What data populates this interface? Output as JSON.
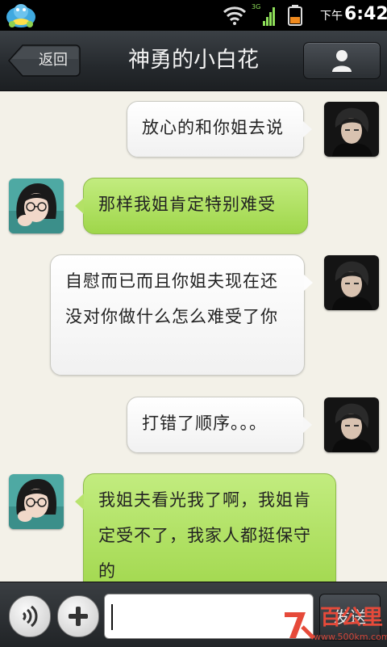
{
  "status_bar": {
    "network_label": "3G",
    "ampm": "下午",
    "time": "6:42",
    "icons": [
      "app-notification-icon",
      "wifi-icon",
      "signal-icon",
      "battery-icon"
    ]
  },
  "header": {
    "back_label": "返回",
    "title": "神勇的小白花",
    "profile_icon": "person-icon"
  },
  "messages": [
    {
      "side": "right",
      "style": "white",
      "text": "放心的和你姐去说",
      "avatar": "friend-avatar"
    },
    {
      "side": "left",
      "style": "green",
      "text": "那样我姐肯定特别难受",
      "avatar": "user-avatar"
    },
    {
      "side": "right",
      "style": "white",
      "text": "自慰而已而且你姐夫现在还没对你做什么怎么难受了你",
      "avatar": "friend-avatar"
    },
    {
      "side": "right",
      "style": "white",
      "text": "打错了顺序。。。",
      "avatar": "friend-avatar"
    },
    {
      "side": "left",
      "style": "green",
      "text": "我姐夫看光我了啊，我姐肯定受不了，我家人都挺保守的",
      "avatar": "user-avatar"
    }
  ],
  "input_bar": {
    "voice_icon": "voice-icon",
    "plus_icon": "plus-icon",
    "input_value": "",
    "send_label": "发送"
  },
  "watermark": {
    "text": "百公里",
    "url": "www.500km.com"
  },
  "colors": {
    "green_bubble": "#a9dd55",
    "white_bubble": "#ffffff",
    "chat_background": "#f3f1e8",
    "bar_dark": "#25292d"
  }
}
